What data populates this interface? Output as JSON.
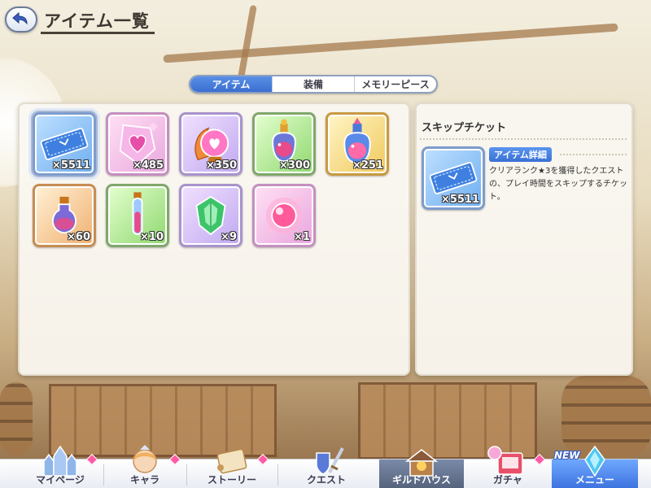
{
  "header": {
    "title": "アイテム一覧"
  },
  "tabs": [
    {
      "label": "アイテム",
      "active": true
    },
    {
      "label": "装備",
      "active": false
    },
    {
      "label": "メモリーピース",
      "active": false
    }
  ],
  "items": [
    {
      "name": "skip-ticket",
      "icon": "ticket-icon",
      "count": "×5511",
      "frame": "blue",
      "selected": true
    },
    {
      "name": "heart-crystal",
      "icon": "heart-crystal-icon",
      "count": "×485",
      "frame": "pink"
    },
    {
      "name": "love-orb",
      "icon": "heart-orb-icon",
      "count": "×350",
      "frame": "purple"
    },
    {
      "name": "potion-large",
      "icon": "potion-icon",
      "count": "×300",
      "frame": "green"
    },
    {
      "name": "potion-gold",
      "icon": "potion-icon",
      "count": "×251",
      "frame": "gold"
    },
    {
      "name": "flask",
      "icon": "flask-icon",
      "count": "×60",
      "frame": "orange"
    },
    {
      "name": "vial",
      "icon": "vial-icon",
      "count": "×10",
      "frame": "green"
    },
    {
      "name": "emerald",
      "icon": "gem-icon",
      "count": "×9",
      "frame": "purple"
    },
    {
      "name": "pink-orb",
      "icon": "orb-icon",
      "count": "×1",
      "frame": "pink"
    }
  ],
  "detail": {
    "title": "スキップチケット",
    "badge": "アイテム詳細",
    "count": "×5511",
    "description": "クリアランク★3を獲得したクエストの、プレイ時間をスキップするチケット。"
  },
  "nav": [
    {
      "label": "マイページ",
      "icon": "castle-icon"
    },
    {
      "label": "キャラ",
      "icon": "character-icon"
    },
    {
      "label": "ストーリー",
      "icon": "scroll-icon"
    },
    {
      "label": "クエスト",
      "icon": "sword-shield-icon"
    },
    {
      "label": "ギルドハウス",
      "icon": "house-icon"
    },
    {
      "label": "ガチャ",
      "icon": "gacha-icon"
    },
    {
      "label": "メニュー",
      "icon": "crystal-icon"
    }
  ],
  "nav_badge": "NEW",
  "colors": {
    "accent": "#3a6fd0",
    "notification": "#ff5aa5"
  }
}
